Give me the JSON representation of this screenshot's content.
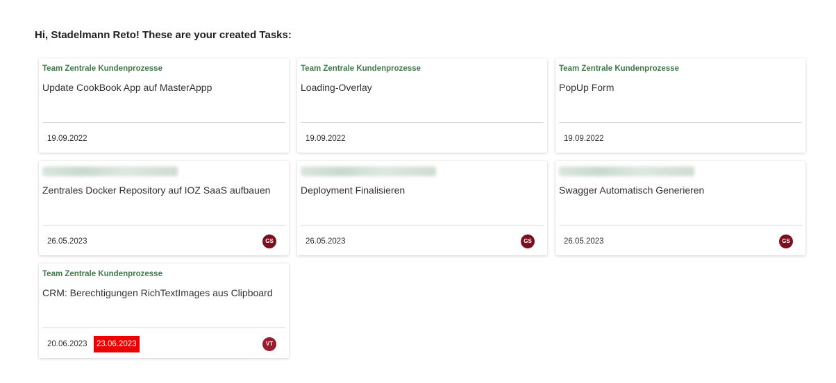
{
  "header": {
    "greeting": "Hi, Stadelmann Reto! These are your created Tasks:"
  },
  "cards": [
    {
      "team": "Team Zentrale Kundenprozesse",
      "title": "Update CookBook App auf MasterAppp",
      "date": "19.09.2022"
    },
    {
      "team": "Team Zentrale Kundenprozesse",
      "title": "Loading-Overlay",
      "date": "19.09.2022"
    },
    {
      "team": "Team Zentrale Kundenprozesse",
      "title": "PopUp Form",
      "date": "19.09.2022"
    },
    {
      "team": "",
      "title": "Zentrales Docker Repository auf IOZ SaaS aufbauen",
      "date": "26.05.2023",
      "avatar": "GS",
      "avatar_color": "#7a1020"
    },
    {
      "team": "",
      "title": "Deployment Finalisieren",
      "date": "26.05.2023",
      "avatar": "GS",
      "avatar_color": "#7a1020"
    },
    {
      "team": "",
      "title": "Swagger Automatisch Generieren",
      "date": "26.05.2023",
      "avatar": "GS",
      "avatar_color": "#7a1020"
    },
    {
      "team": "Team Zentrale Kundenprozesse",
      "title": "CRM: Berechtigungen RichTextImages aus Clipboard",
      "date": "20.06.2023",
      "due_date": "23.06.2023",
      "due_color": "#ee0000",
      "avatar": "VT",
      "avatar_color": "#9b1c2c"
    }
  ]
}
